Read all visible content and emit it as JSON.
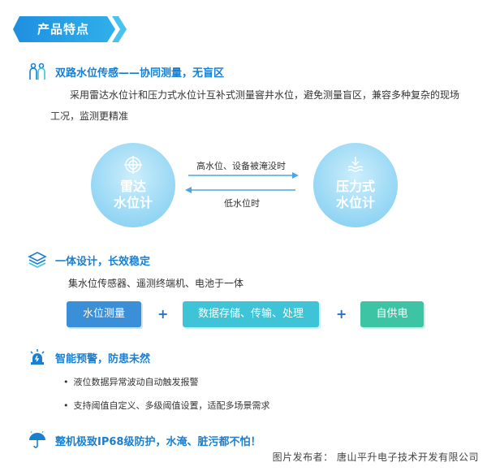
{
  "banner": {
    "title": "产品特点"
  },
  "sections": {
    "s1": {
      "title": "双路水位传感——协同测量，无盲区",
      "desc": "采用雷达水位计和压力式水位计互补式测量窨井水位，避免测量盲区，兼容多种复杂的现场工况，监测更精准"
    },
    "diagram": {
      "left_line1": "雷达",
      "left_line2": "水位计",
      "right_line1": "压力式",
      "right_line2": "水位计",
      "arrow_top": "高水位、设备被淹没时",
      "arrow_bottom": "低水位时"
    },
    "s2": {
      "title": "一体设计，长效稳定",
      "desc": "集水位传感器、遥测终端机、电池于一体",
      "pills": [
        "水位测量",
        "数据存储、传输、处理",
        "自供电"
      ],
      "plus": "+"
    },
    "s3": {
      "title": "智能预警，防患未然",
      "bullets": [
        "液位数据异常波动自动触发报警",
        "支持阈值自定义、多级阈值设置，适配多场景需求"
      ]
    },
    "s4": {
      "title": "整机极致IP68级防护，水淹、脏污都不怕！"
    }
  },
  "credit": "图片发布者： 唐山平升电子技术开发有限公司",
  "colors": {
    "accent_blue": "#1a7fd0",
    "pill_blue": "#3a8fd8",
    "pill_teal": "#3ec4d6",
    "pill_green": "#3cc4a4",
    "circle_light": "#9bd9f5"
  }
}
